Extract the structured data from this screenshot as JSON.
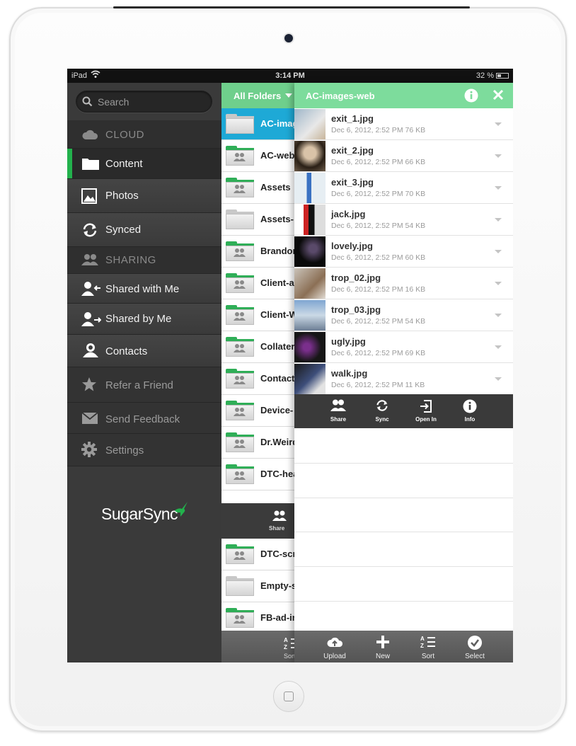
{
  "status_bar": {
    "carrier": "iPad",
    "time": "3:14 PM",
    "battery": "32 %"
  },
  "sidebar": {
    "search_placeholder": "Search",
    "sections": {
      "cloud": "CLOUD",
      "sharing": "SHARING"
    },
    "items": {
      "content": "Content",
      "photos": "Photos",
      "synced": "Synced",
      "shared_with_me": "Shared with Me",
      "shared_by_me": "Shared by Me",
      "contacts": "Contacts",
      "refer": "Refer a Friend",
      "feedback": "Send Feedback",
      "settings": "Settings"
    },
    "logo": "SugarSync"
  },
  "folders": {
    "header": "All Folders",
    "items": [
      {
        "name": "AC-images-web",
        "shared": false,
        "selected": true
      },
      {
        "name": "AC-web",
        "shared": true
      },
      {
        "name": "Assets",
        "shared": true
      },
      {
        "name": "Assets-",
        "shared": false
      },
      {
        "name": "Brandon",
        "shared": true
      },
      {
        "name": "Client-a",
        "shared": true
      },
      {
        "name": "Client-W",
        "shared": true
      },
      {
        "name": "Collater",
        "shared": true
      },
      {
        "name": "Contact",
        "shared": true
      },
      {
        "name": "Device-",
        "shared": true
      },
      {
        "name": "Dr.Weird",
        "shared": true
      },
      {
        "name": "DTC-hea",
        "shared": true
      },
      {
        "name": "DTC-scr",
        "shared": true
      },
      {
        "name": "Empty-s",
        "shared": false
      },
      {
        "name": "FB-ad-in",
        "shared": true
      }
    ],
    "share_label": "Share",
    "sort_label": "Sort"
  },
  "detail": {
    "title": "AC-images-web",
    "files": [
      {
        "name": "exit_1.jpg",
        "meta": "Dec 6, 2012, 2:52 PM 76 KB"
      },
      {
        "name": "exit_2.jpg",
        "meta": "Dec 6, 2012, 2:52 PM 66 KB"
      },
      {
        "name": "exit_3.jpg",
        "meta": "Dec 6, 2012, 2:52 PM 70 KB"
      },
      {
        "name": "jack.jpg",
        "meta": "Dec 6, 2012, 2:52 PM 54 KB"
      },
      {
        "name": "lovely.jpg",
        "meta": "Dec 6, 2012, 2:52 PM 60 KB"
      },
      {
        "name": "trop_02.jpg",
        "meta": "Dec 6, 2012, 2:52 PM 16 KB"
      },
      {
        "name": "trop_03.jpg",
        "meta": "Dec 6, 2012, 2:52 PM 54 KB"
      },
      {
        "name": "ugly.jpg",
        "meta": "Dec 6, 2012, 2:52 PM 69 KB"
      },
      {
        "name": "walk.jpg",
        "meta": "Dec 6, 2012, 2:52 PM 11 KB"
      }
    ],
    "actions": {
      "share": "Share",
      "sync": "Sync",
      "open_in": "Open In",
      "info": "Info"
    },
    "toolbar": {
      "upload": "Upload",
      "new": "New",
      "sort": "Sort",
      "select": "Select"
    }
  },
  "colors": {
    "accent_green": "#22b14c",
    "header_green": "#7ddc9c",
    "selection_blue": "#1ea9d6",
    "sidebar_bg": "#3a3a3a"
  }
}
